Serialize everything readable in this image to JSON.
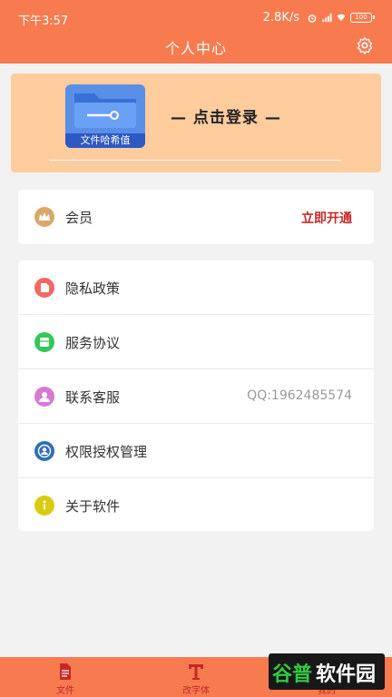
{
  "status_bar": {
    "time": "下午3:57",
    "net_speed": "2.8K/s",
    "battery": "100"
  },
  "header": {
    "title": "个人中心",
    "settings_icon": "gear-icon"
  },
  "login": {
    "logo_caption": "文件哈希值",
    "prompt": "— 点击登录 —"
  },
  "vip": {
    "label": "会员",
    "action": "立即开通",
    "icon": "crown-icon"
  },
  "menu": {
    "items": [
      {
        "label": "隐私政策",
        "value": "",
        "icon": "document-icon",
        "color": "#ef6a63"
      },
      {
        "label": "服务协议",
        "value": "",
        "icon": "box-icon",
        "color": "#35c759"
      },
      {
        "label": "联系客服",
        "value": "QQ:1962485574",
        "icon": "person-icon",
        "color": "#d77ad3"
      },
      {
        "label": "权限授权管理",
        "value": "",
        "icon": "user-circle-icon",
        "color": "#2f6fb8"
      },
      {
        "label": "关于软件",
        "value": "",
        "icon": "info-icon",
        "color": "#d8cc12"
      }
    ]
  },
  "tabbar": {
    "tabs": [
      {
        "label": "文件",
        "icon": "file-icon"
      },
      {
        "label": "改字体",
        "icon": "text-icon"
      },
      {
        "label": "我的",
        "icon": "user-icon"
      }
    ]
  },
  "watermark": {
    "part1": "谷普",
    "part2": "软件园"
  },
  "colors": {
    "accent": "#f77b4e",
    "login_bg": "#ffcc9e",
    "action_red": "#c62828"
  }
}
